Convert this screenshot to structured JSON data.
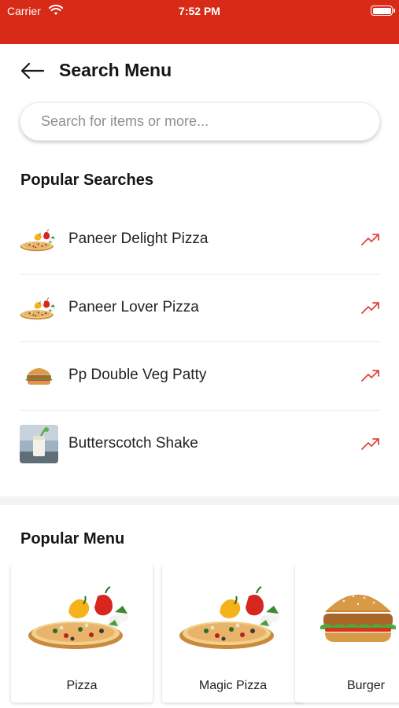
{
  "status_bar": {
    "carrier": "Carrier",
    "time": "7:52 PM"
  },
  "header": {
    "title": "Search Menu",
    "back_icon": "arrow-left-icon"
  },
  "search": {
    "placeholder": "Search for items or more..."
  },
  "popular_searches": {
    "title": "Popular Searches",
    "items": [
      {
        "label": "Paneer Delight Pizza",
        "thumb": "pizza",
        "icon": "trending-up-icon"
      },
      {
        "label": "Paneer Lover Pizza",
        "thumb": "pizza",
        "icon": "trending-up-icon"
      },
      {
        "label": "Pp Double Veg Patty",
        "thumb": "burger",
        "icon": "trending-up-icon"
      },
      {
        "label": "Butterscotch Shake",
        "thumb": "shake",
        "icon": "trending-up-icon"
      }
    ]
  },
  "popular_menu": {
    "title": "Popular Menu",
    "items": [
      {
        "label": "Pizza",
        "image": "pizza"
      },
      {
        "label": "Magic Pizza",
        "image": "pizza"
      },
      {
        "label": "Burger",
        "image": "burger"
      }
    ]
  },
  "colors": {
    "brand_red": "#d72a17",
    "trend_red": "#e0463a"
  }
}
